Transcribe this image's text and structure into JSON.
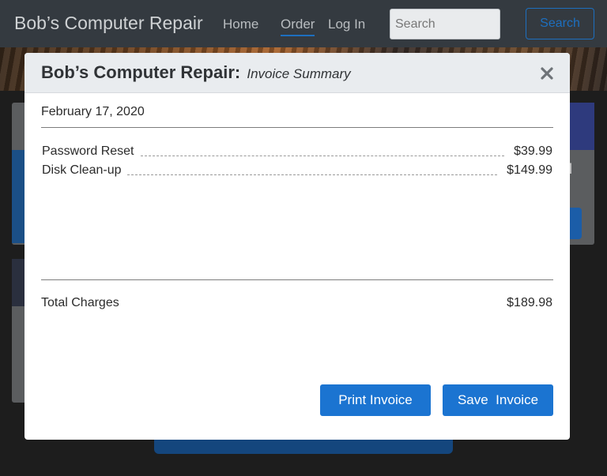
{
  "navbar": {
    "brand": "Bob’s Computer Repair",
    "links": [
      {
        "label": "Home"
      },
      {
        "label": "Order"
      },
      {
        "label": "Log In"
      }
    ],
    "search_placeholder": "Search",
    "search_button": "Search"
  },
  "background": {
    "card_partial_text": "ll"
  },
  "modal": {
    "title": "Bob’s Computer Repair:",
    "subtitle": "Invoice Summary",
    "close_icon": "close-icon",
    "date": "February 17, 2020",
    "line_items": [
      {
        "description": "Password Reset",
        "price": "$39.99"
      },
      {
        "description": "Disk Clean-up",
        "price": "$149.99"
      }
    ],
    "total_label": "Total Charges",
    "total_value": "$189.98",
    "print_button": "Print Invoice",
    "save_button": "Save  Invoice"
  },
  "colors": {
    "primary": "#1b74d1",
    "navbar": "#343a40",
    "modal_header": "#e9ecef"
  }
}
